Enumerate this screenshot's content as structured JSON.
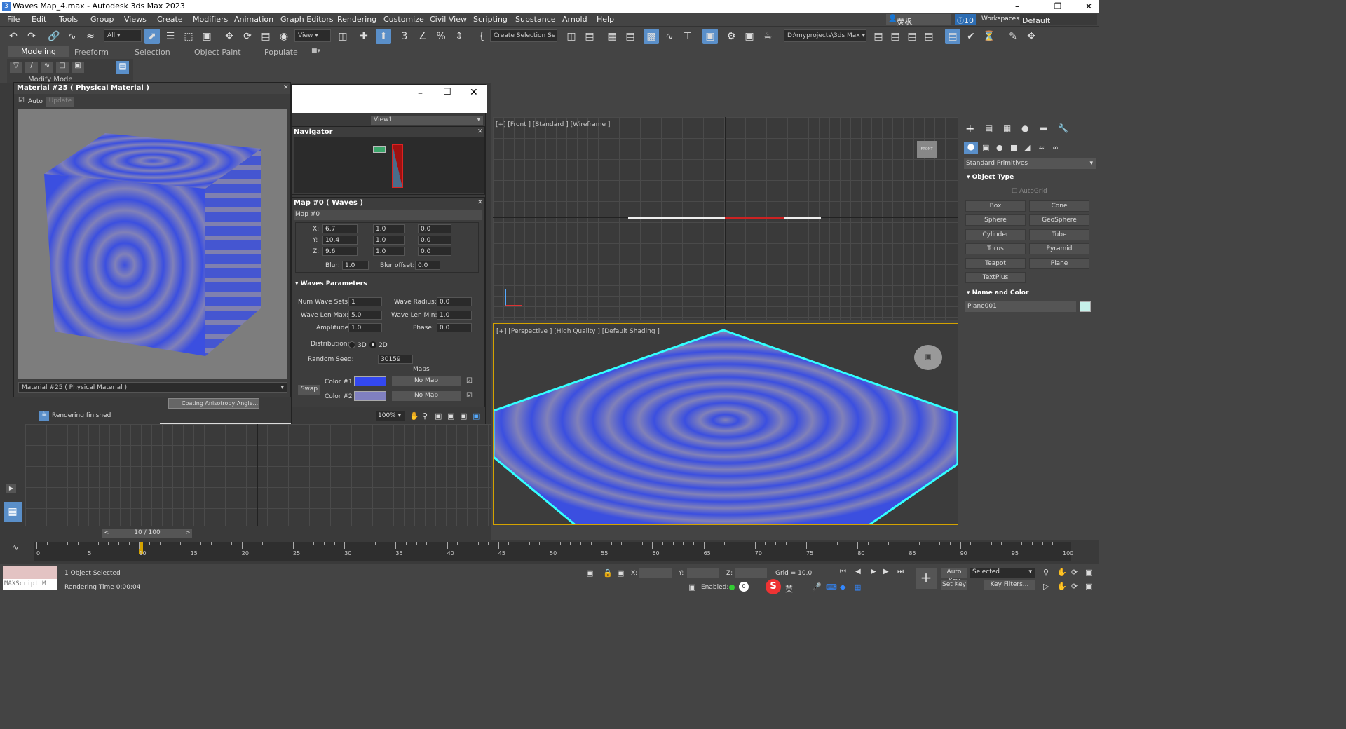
{
  "window": {
    "title": "Waves Map_4.max - Autodesk 3ds Max 2023"
  },
  "menu": [
    "File",
    "Edit",
    "Tools",
    "Group",
    "Views",
    "Create",
    "Modifiers",
    "Animation",
    "Graph Editors",
    "Rendering",
    "Customize",
    "Civil View",
    "Scripting",
    "Substance",
    "Arnold",
    "Help"
  ],
  "menu_right": {
    "user": "荧枫",
    "count": "10",
    "workspaces_label": "Workspaces:",
    "workspace": "Default"
  },
  "toolbar": {
    "filter": "All",
    "ref_coord": "View",
    "selection_set": "Create Selection Se",
    "project_path": "D:\\myprojects\\3ds Max"
  },
  "ribbon": {
    "tabs": [
      "Modeling",
      "Freeform",
      "Selection",
      "Object Paint",
      "Populate"
    ],
    "sub": "Modify Mode"
  },
  "material_preview": {
    "title": "Material #25  ( Physical Material )",
    "auto_label": "Auto",
    "update_label": "Update",
    "dropdown": "Material #25  ( Physical Material )"
  },
  "slate": {
    "view_dropdown": "View1",
    "navigator_title": "Navigator",
    "map_title": "Map #0  ( Waves )",
    "map_name": "Map #0",
    "coords": {
      "x": [
        "6.7",
        "1.0",
        "0.0"
      ],
      "y": [
        "10.4",
        "1.0",
        "0.0"
      ],
      "z": [
        "9.6",
        "1.0",
        "0.0"
      ]
    },
    "blur_label": "Blur:",
    "blur": "1.0",
    "blur_offset_label": "Blur offset:",
    "blur_offset": "0.0",
    "waves_title": "Waves Parameters",
    "num_wave_sets_label": "Num Wave Sets:",
    "num_wave_sets": "1",
    "wave_radius_label": "Wave Radius:",
    "wave_radius": "0.0",
    "wave_len_max_label": "Wave Len Max:",
    "wave_len_max": "5.0",
    "wave_len_min_label": "Wave Len Min:",
    "wave_len_min": "1.0",
    "amplitude_label": "Amplitude:",
    "amplitude": "1.0",
    "phase_label": "Phase:",
    "phase": "0.0",
    "distribution_label": "Distribution:",
    "dist_3d": "3D",
    "dist_2d": "2D",
    "random_seed_label": "Random Seed:",
    "random_seed": "30159",
    "maps_label": "Maps",
    "color1_label": "Color #1",
    "color2_label": "Color #2",
    "no_map": "No Map",
    "swap_label": "Swap",
    "color1": "#3348f0",
    "color2": "#8080c0",
    "status": "Rendering finished",
    "zoom": "100%",
    "node_label": "Coating Anisotropy Angle..."
  },
  "viewports": {
    "front": "[+] [Front ] [Standard ] [Wireframe ]",
    "perspective": "[+] [Perspective ] [High Quality ] [Default Shading ]"
  },
  "command_panel": {
    "category": "Standard Primitives",
    "object_type": "Object Type",
    "autogrid": "AutoGrid",
    "buttons": [
      "Box",
      "Cone",
      "Sphere",
      "GeoSphere",
      "Cylinder",
      "Tube",
      "Torus",
      "Pyramid",
      "Teapot",
      "Plane",
      "TextPlus"
    ],
    "name_color": "Name and Color",
    "object_name": "Plane001",
    "object_color": "#c6f1ea"
  },
  "timeline": {
    "frame": "10 / 100",
    "ticks": [
      "0",
      "5",
      "10",
      "15",
      "20",
      "25",
      "30",
      "35",
      "40",
      "45",
      "50",
      "55",
      "60",
      "65",
      "70",
      "75",
      "80",
      "85",
      "90",
      "95",
      "100"
    ]
  },
  "status": {
    "selected": "1 Object Selected",
    "render_time": "Rendering Time  0:00:04",
    "maxscript": "MAXScript Mi",
    "x_label": "X:",
    "y_label": "Y:",
    "z_label": "Z:",
    "grid": "Grid = 10.0",
    "enabled": "Enabled:",
    "auto_key": "Auto Key",
    "selected_dd": "Selected",
    "set_key": "Set Key",
    "key_filters": "Key Filters...",
    "ime": "英"
  }
}
